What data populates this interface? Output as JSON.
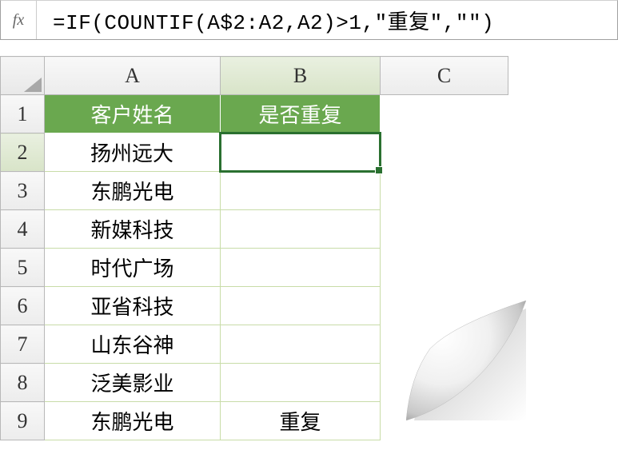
{
  "formulaBar": {
    "fxLabel": "fx",
    "formula": "=IF(COUNTIF(A$2:A2,A2)>1,\"重复\",\"\")"
  },
  "columns": [
    "A",
    "B",
    "C"
  ],
  "activeColumn": "B",
  "activeRow": 2,
  "selectedCell": "B2",
  "headerRow": {
    "A": "客户姓名",
    "B": "是否重复"
  },
  "rows": [
    {
      "num": 1,
      "A": "客户姓名",
      "B": "是否重复",
      "isHeader": true
    },
    {
      "num": 2,
      "A": "扬州远大",
      "B": ""
    },
    {
      "num": 3,
      "A": "东鹏光电",
      "B": ""
    },
    {
      "num": 4,
      "A": "新媒科技",
      "B": ""
    },
    {
      "num": 5,
      "A": "时代广场",
      "B": ""
    },
    {
      "num": 6,
      "A": "亚省科技",
      "B": ""
    },
    {
      "num": 7,
      "A": "山东谷神",
      "B": ""
    },
    {
      "num": 8,
      "A": "泛美影业",
      "B": ""
    },
    {
      "num": 9,
      "A": "东鹏光电",
      "B": "重复"
    }
  ]
}
